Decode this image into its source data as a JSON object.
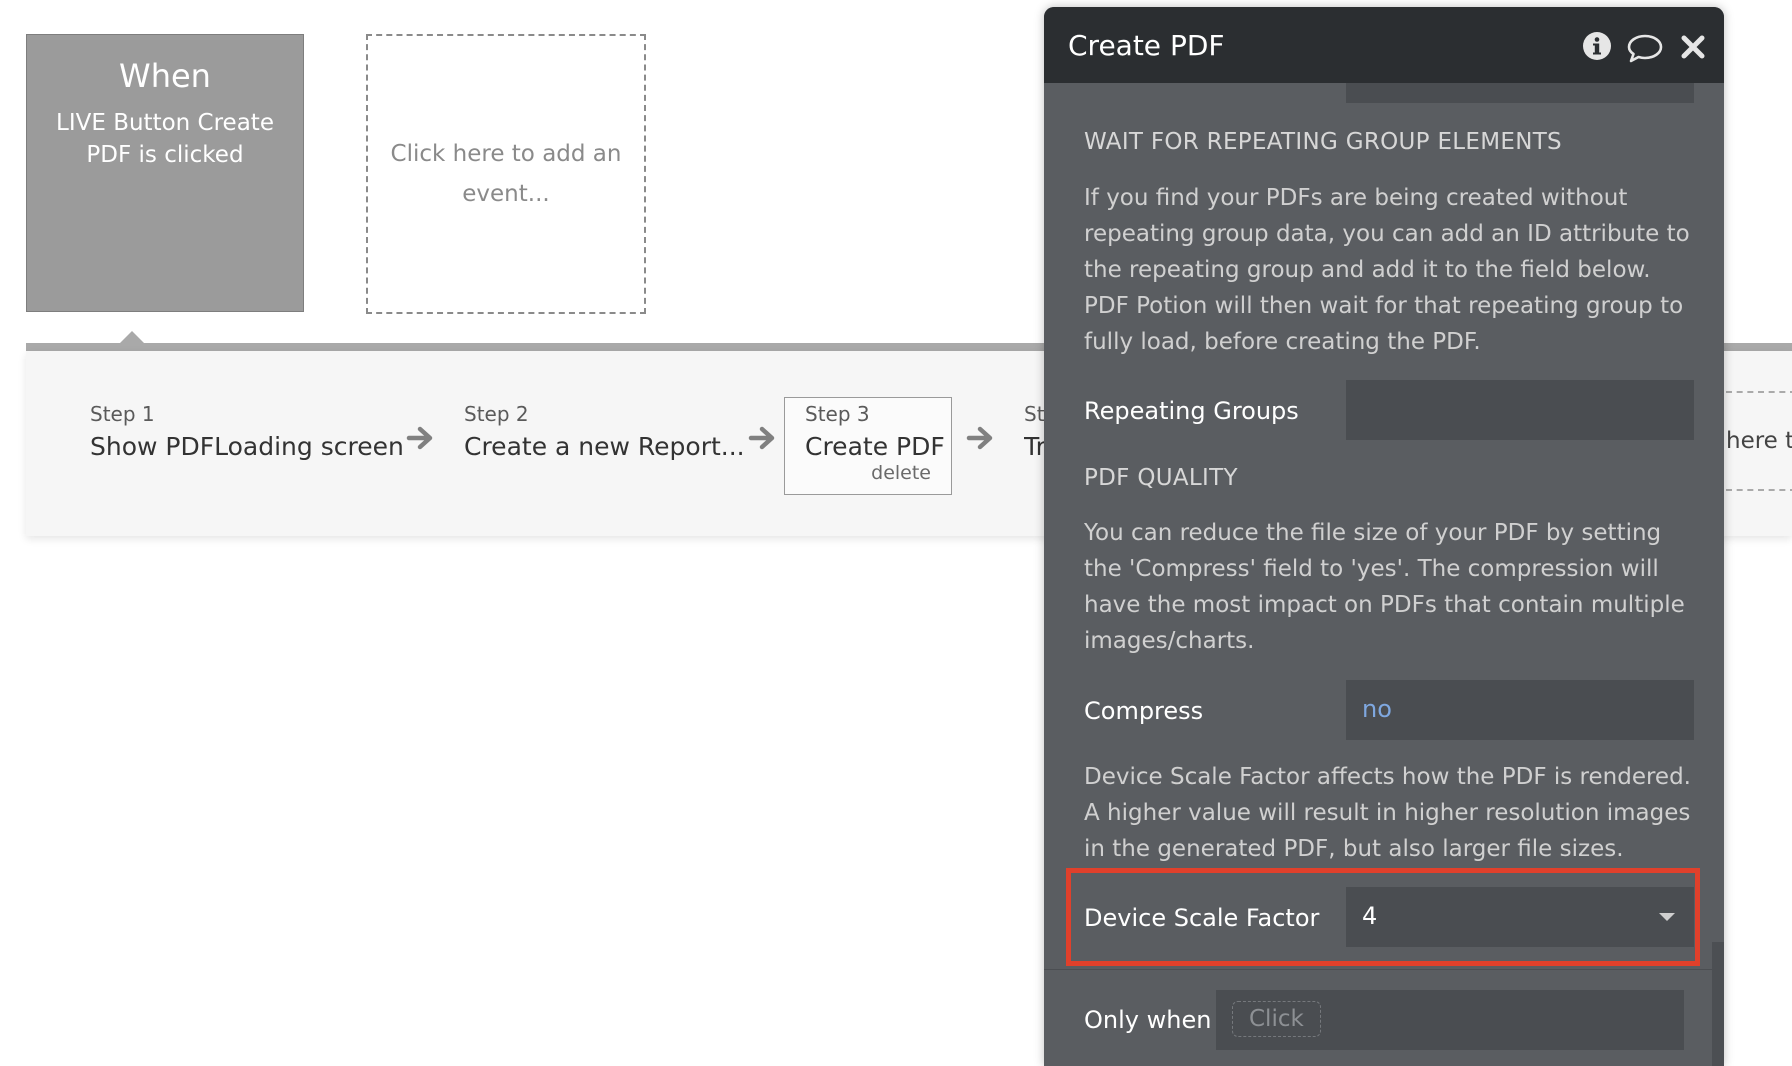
{
  "event": {
    "title": "When",
    "description": "LIVE Button Create PDF is clicked",
    "add_event_label": "Click here to add an event..."
  },
  "steps": [
    {
      "number": "Step 1",
      "label": "Show PDFLoading screen"
    },
    {
      "number": "Step 2",
      "label": "Create a new Report..."
    },
    {
      "number": "Step 3",
      "label": "Create PDF",
      "action": "delete"
    },
    {
      "number": "St",
      "label": "Tr"
    }
  ],
  "add_step_label": "here to",
  "panel": {
    "title": "Create PDF",
    "icons": [
      "info-icon",
      "comment-icon",
      "close-icon"
    ],
    "sections": {
      "wait_title": "WAIT FOR REPEATING GROUP ELEMENTS",
      "wait_text": "If you find your PDFs are being created without repeating group data, you can add an ID attribute to the repeating group and add it to the field below. PDF Potion will then wait for that repeating group to fully load, before creating the PDF.",
      "quality_title": "PDF QUALITY",
      "quality_text": "You can reduce the file size of your PDF by setting the 'Compress' field to 'yes'. The compression will have the most impact on PDFs that contain multiple images/charts.",
      "scale_text": "Device Scale Factor affects how the PDF is rendered. A higher value will result in higher resolution images in the generated PDF, but also larger file sizes."
    },
    "fields": {
      "repeating_groups_label": "Repeating Groups",
      "repeating_groups_value": "",
      "compress_label": "Compress",
      "compress_value": "no",
      "scale_label": "Device Scale Factor",
      "scale_value": "4",
      "only_when_label": "Only when",
      "only_when_placeholder": "Click"
    }
  },
  "colors": {
    "panel_bg": "#5a5d61",
    "panel_header": "#2b2e31",
    "field_bg": "#4a4d51",
    "link_value": "#7fa8e0",
    "highlight": "#e0402b"
  }
}
